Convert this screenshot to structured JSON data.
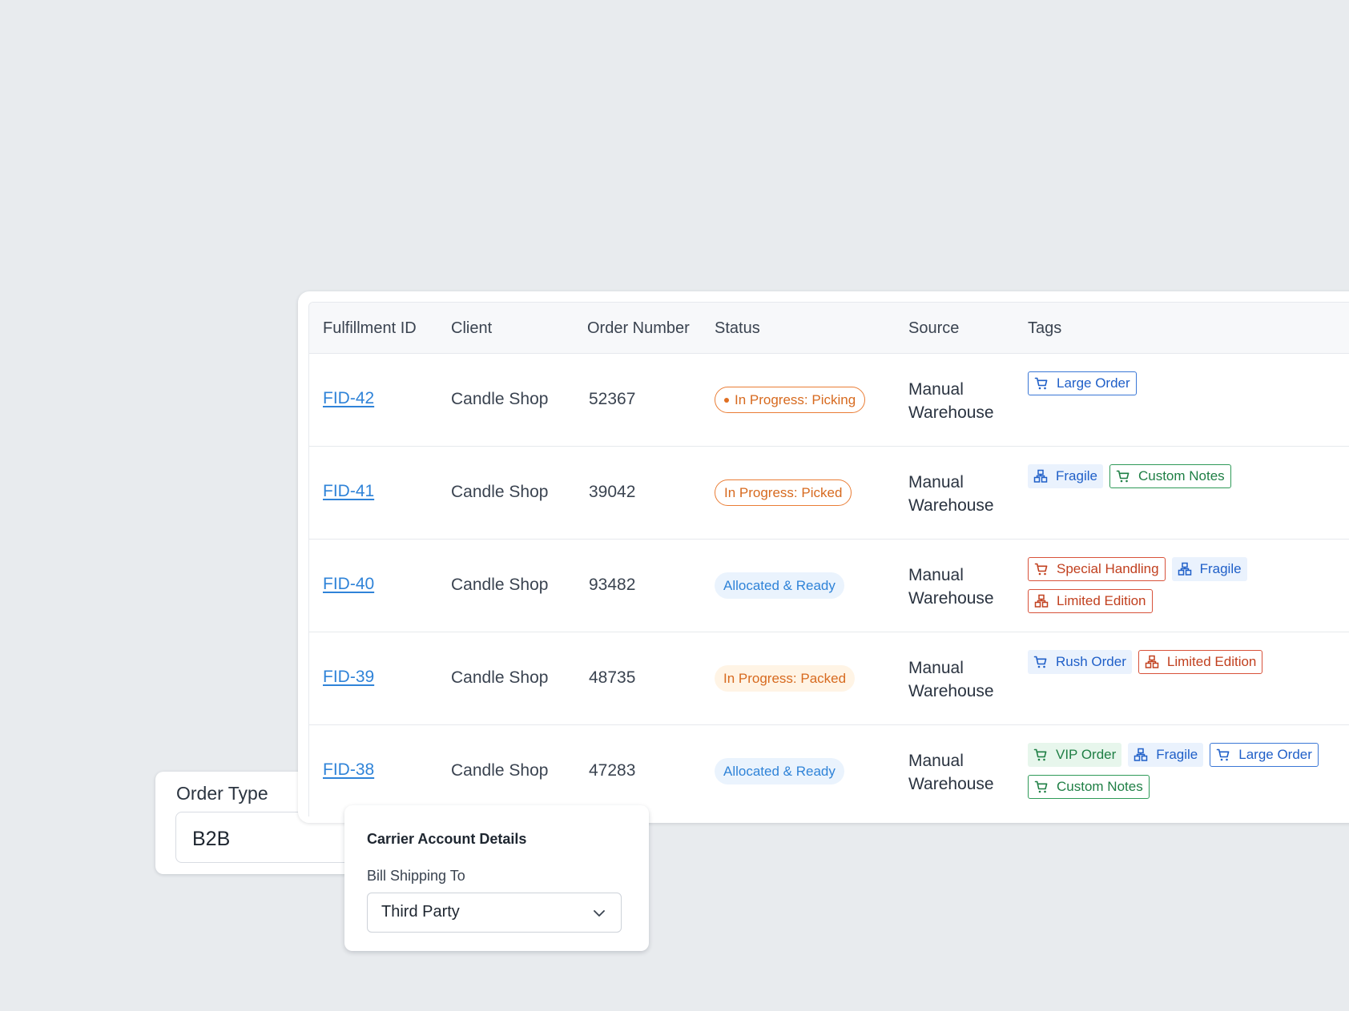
{
  "table": {
    "columns": [
      "Fulfillment ID",
      "Client",
      "Order Number",
      "Status",
      "Source",
      "Tags"
    ],
    "rows": [
      {
        "id": "FID-42",
        "client": "Candle Shop",
        "order": "52367",
        "status": {
          "label": "In Progress: Picking",
          "style": "outline",
          "dot": true
        },
        "source": "Manual Warehouse",
        "tags": [
          {
            "label": "Large Order",
            "icon": "cart-icon",
            "style": "blue-out"
          }
        ]
      },
      {
        "id": "FID-41",
        "client": "Candle Shop",
        "order": "39042",
        "status": {
          "label": "In Progress: Picked",
          "style": "outline",
          "dot": false
        },
        "source": "Manual Warehouse",
        "tags": [
          {
            "label": "Fragile",
            "icon": "boxes-icon",
            "style": "blue-soft"
          },
          {
            "label": "Custom Notes",
            "icon": "cart-icon",
            "style": "green-out"
          }
        ]
      },
      {
        "id": "FID-40",
        "client": "Candle Shop",
        "order": "93482",
        "status": {
          "label": "Allocated & Ready",
          "style": "soft-blue",
          "dot": false
        },
        "source": "Manual Warehouse",
        "tags": [
          {
            "label": "Special Handling",
            "icon": "cart-icon",
            "style": "red-out"
          },
          {
            "label": "Fragile",
            "icon": "boxes-icon",
            "style": "blue-soft"
          },
          {
            "label": "Limited Edition",
            "icon": "boxes-icon",
            "style": "red-out"
          }
        ]
      },
      {
        "id": "FID-39",
        "client": "Candle Shop",
        "order": "48735",
        "status": {
          "label": "In Progress: Packed",
          "style": "soft-orange",
          "dot": false
        },
        "source": "Manual Warehouse",
        "tags": [
          {
            "label": "Rush Order",
            "icon": "cart-icon",
            "style": "blue-soft"
          },
          {
            "label": "Limited Edition",
            "icon": "boxes-icon",
            "style": "red-out"
          }
        ]
      },
      {
        "id": "FID-38",
        "client": "Candle Shop",
        "order": "47283",
        "status": {
          "label": "Allocated & Ready",
          "style": "soft-blue",
          "dot": false
        },
        "source": "Manual Warehouse",
        "tags": [
          {
            "label": "VIP Order",
            "icon": "cart-icon",
            "style": "green-soft"
          },
          {
            "label": "Fragile",
            "icon": "boxes-icon",
            "style": "blue-soft"
          },
          {
            "label": "Large Order",
            "icon": "cart-icon",
            "style": "blue-out"
          },
          {
            "label": "Custom Notes",
            "icon": "cart-icon",
            "style": "green-out"
          }
        ]
      }
    ]
  },
  "order_type": {
    "label": "Order Type",
    "value": "B2B"
  },
  "carrier": {
    "title": "Carrier Account Details",
    "bill_label": "Bill Shipping To",
    "bill_value": "Third Party",
    "dropdown_icon": "chevron-down-icon"
  },
  "colors": {
    "background": "#e8ebee",
    "link": "#2f83d8",
    "status_orange": "#d76a1f",
    "tag_blue": "#1f5fc8",
    "tag_green": "#1f7f45",
    "tag_red": "#c1401f"
  }
}
